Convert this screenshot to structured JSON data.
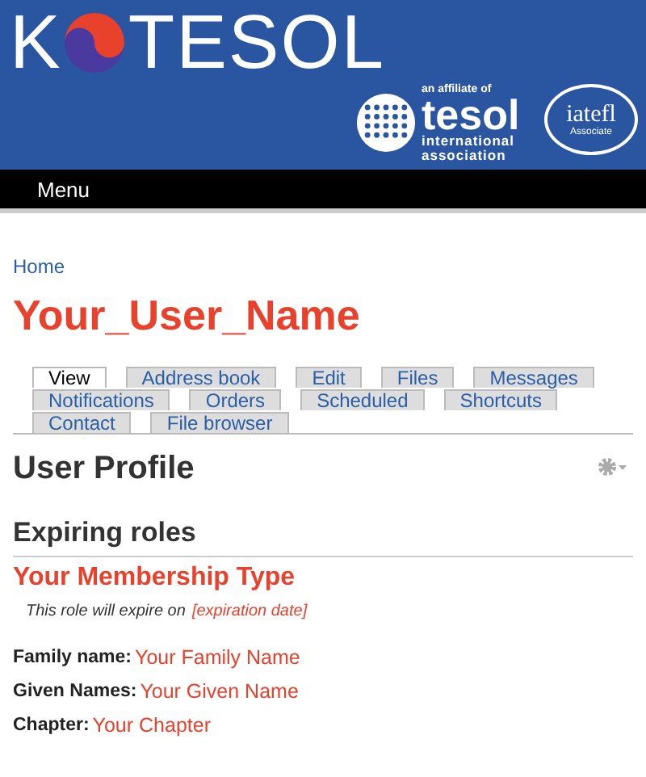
{
  "header": {
    "logo_before": "K",
    "logo_after": "TESOL",
    "affiliate": {
      "small": "an affiliate of",
      "name": "tesol",
      "line1": "international",
      "line2": "association"
    },
    "associate": {
      "name": "iatefl",
      "sub": "Associate"
    }
  },
  "menu": "Menu",
  "breadcrumb": "Home",
  "user_name": "Your_User_Name",
  "tabs": [
    {
      "label": "View",
      "selected": true
    },
    {
      "label": "Address book",
      "selected": false
    },
    {
      "label": "Edit",
      "selected": false
    },
    {
      "label": "Files",
      "selected": false
    },
    {
      "label": "Messages",
      "selected": false
    },
    {
      "label": "Notifications",
      "selected": false
    },
    {
      "label": "Orders",
      "selected": false
    },
    {
      "label": "Scheduled",
      "selected": false
    },
    {
      "label": "Shortcuts",
      "selected": false
    },
    {
      "label": "Contact",
      "selected": false
    },
    {
      "label": "File browser",
      "selected": false
    }
  ],
  "page_title": "User Profile",
  "section_title": "Expiring roles",
  "role": {
    "name": "Your Membership Type",
    "note": "This role will expire on",
    "date": "[expiration date]"
  },
  "fields": [
    {
      "label": "Family name:",
      "value": "Your Family Name"
    },
    {
      "label": "Given Names:",
      "value": "Your Given Name"
    },
    {
      "label": "Chapter:",
      "value": "Your Chapter"
    }
  ]
}
